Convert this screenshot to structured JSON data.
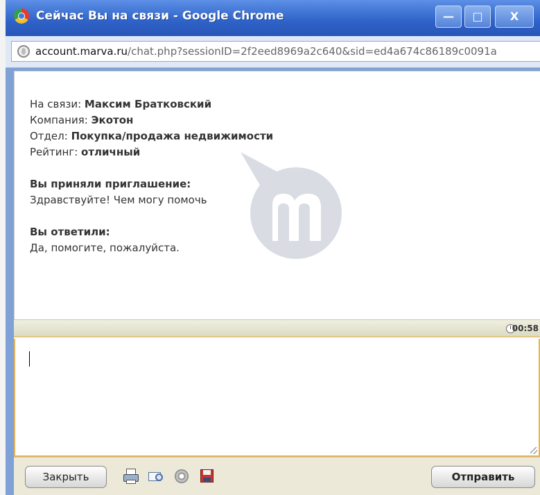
{
  "window": {
    "title": "Сейчас Вы на связи - Google Chrome",
    "controls": {
      "minimize": "—",
      "maximize": "□",
      "close": "X"
    }
  },
  "address": {
    "host": "account.marva.ru",
    "path": "/chat.php?sessionID=2f2eed8969a2c640&sid=ed4a674c86189c0091a"
  },
  "chat": {
    "info": [
      {
        "label": "На связи: ",
        "value": "Максим Братковский"
      },
      {
        "label": "Компания: ",
        "value": "Экотон"
      },
      {
        "label": "Отдел: ",
        "value": "Покупка/продажа недвижимости"
      },
      {
        "label": "Рейтинг: ",
        "value": "отличный"
      }
    ],
    "messages": [
      {
        "header": "Вы приняли приглашение:",
        "text": "Здравствуйте! Чем могу помочь"
      },
      {
        "header": "Вы ответили:",
        "text": "Да, помогите, пожалуйста."
      }
    ]
  },
  "status": {
    "timer": "00:58"
  },
  "input": {
    "value": ""
  },
  "toolbar": {
    "close_label": "Закрыть",
    "send_label": "Отправить",
    "icons": [
      "print-icon",
      "email-transcript-icon",
      "sound-icon",
      "save-icon"
    ]
  },
  "colors": {
    "titlebar": "#2e62c8",
    "input_border": "#e2b55c",
    "toolbar_bg": "#ece9d8"
  }
}
